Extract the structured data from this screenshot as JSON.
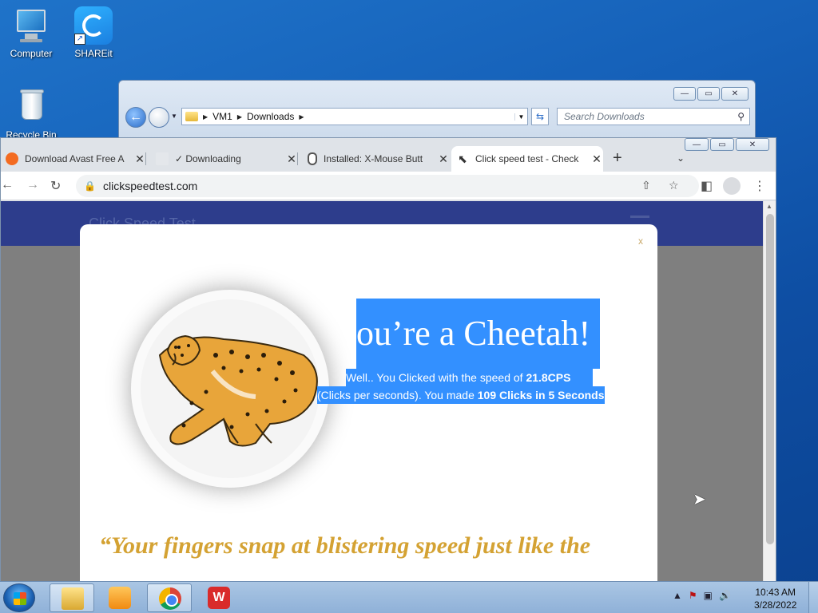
{
  "desktop": {
    "icons": [
      {
        "label": "Computer"
      },
      {
        "label": "SHAREit"
      },
      {
        "label": "Recycle Bin"
      }
    ]
  },
  "explorer": {
    "breadcrumb": [
      "VM1",
      "Downloads"
    ],
    "search_placeholder": "Search Downloads",
    "icons": {
      "back": "back-arrow-icon",
      "forward": "forward-arrow-icon",
      "refresh": "refresh-icon",
      "search": "search-icon"
    }
  },
  "chrome": {
    "tabs": [
      {
        "title": "Download Avast Free A",
        "favicon": "avast-icon"
      },
      {
        "title": "Downloading",
        "favicon": "document-icon"
      },
      {
        "title": "Installed: X-Mouse Butt",
        "favicon": "mouse-icon"
      },
      {
        "title": "Click speed test - Check",
        "favicon": "cursor-click-icon",
        "active": true
      }
    ],
    "url": "clickspeedtest.com",
    "colors": {
      "header": "#2d3d8c",
      "selection": "#3390ff",
      "quote": "#d4a233"
    }
  },
  "page": {
    "brand": "Click Speed Test",
    "modal": {
      "close_label": "x",
      "title": "ou’re a Cheetah!",
      "line1_prefix": "Well.. You Clicked with the speed of ",
      "cps": "21.8CPS",
      "line2_prefix": "(Clicks per seconds). You made ",
      "clicks_summary": "109 Clicks in 5 Seconds",
      "quote": "“Your fingers snap at blistering speed just like the",
      "badge_icon": "cheetah-icon"
    }
  },
  "taskbar": {
    "apps": [
      "explorer-icon",
      "media-player-icon",
      "chrome-icon",
      "wps-icon"
    ],
    "clock": {
      "time": "10:43 AM",
      "date": "3/28/2022"
    }
  }
}
